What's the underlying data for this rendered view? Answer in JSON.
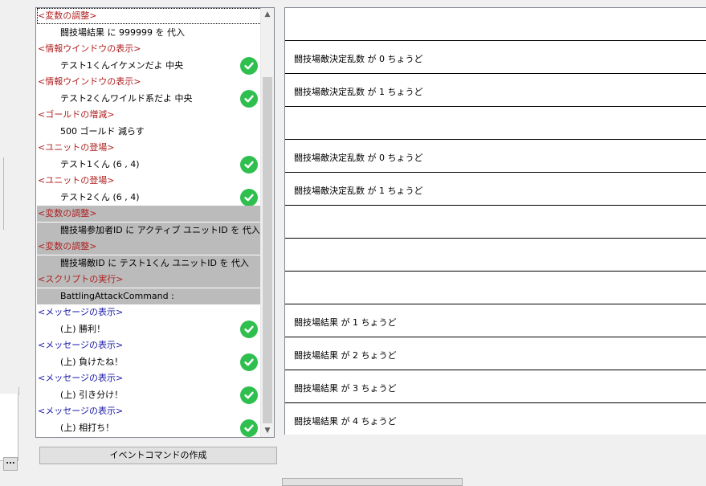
{
  "command_list": {
    "rows": [
      {
        "text": "<変数の調整>",
        "kind": "head",
        "color": "#b02020"
      },
      {
        "text": "闘技場結果 に 999999 を 代入",
        "kind": "sub",
        "check": false
      },
      {
        "text": "<情報ウインドウの表示>",
        "kind": "head",
        "color": "#b02020"
      },
      {
        "text": "テスト1くんイケメンだよ 中央",
        "kind": "sub",
        "check": true
      },
      {
        "text": "<情報ウインドウの表示>",
        "kind": "head",
        "color": "#b02020"
      },
      {
        "text": "テスト2くんワイルド系だよ 中央",
        "kind": "sub",
        "check": true
      },
      {
        "text": "<ゴールドの増減>",
        "kind": "head",
        "color": "#b02020"
      },
      {
        "text": "500 ゴールド 減らす",
        "kind": "sub",
        "check": false
      },
      {
        "text": "<ユニットの登場>",
        "kind": "head",
        "color": "#b02020"
      },
      {
        "text": "テスト1くん (6 , 4)",
        "kind": "sub",
        "check": true
      },
      {
        "text": "<ユニットの登場>",
        "kind": "head",
        "color": "#b02020"
      },
      {
        "text": "テスト2くん (6 , 4)",
        "kind": "sub",
        "check": true
      },
      {
        "text": "<変数の調整>",
        "kind": "head",
        "color": "#b02020",
        "selected": true
      },
      {
        "text": "闘技場参加者ID に アクティブ ユニットID を 代入",
        "kind": "sub",
        "selected": true
      },
      {
        "text": "<変数の調整>",
        "kind": "head",
        "color": "#b02020",
        "selected": true
      },
      {
        "text": "闘技場敵ID に テスト1くん ユニットID を 代入",
        "kind": "sub",
        "selected": true
      },
      {
        "text": "<スクリプトの実行>",
        "kind": "head",
        "color": "#b02020",
        "selected": true
      },
      {
        "text": "BattlingAttackCommand :",
        "kind": "sub",
        "selected": true
      },
      {
        "text": "<メッセージの表示>",
        "kind": "head",
        "color": "#1a1aa8"
      },
      {
        "text": "(上) 勝利！",
        "kind": "sub",
        "check": true
      },
      {
        "text": "<メッセージの表示>",
        "kind": "head",
        "color": "#1a1aa8"
      },
      {
        "text": "(上) 負けたね！",
        "kind": "sub",
        "check": true
      },
      {
        "text": "<メッセージの表示>",
        "kind": "head",
        "color": "#1a1aa8"
      },
      {
        "text": "(上) 引き分け！",
        "kind": "sub",
        "check": true
      },
      {
        "text": "<メッセージの表示>",
        "kind": "head",
        "color": "#1a1aa8"
      },
      {
        "text": "(上) 相打ち！",
        "kind": "sub",
        "check": true
      }
    ]
  },
  "conditions": [
    "",
    "闘技場敵決定乱数 が 0 ちょうど",
    "闘技場敵決定乱数 が 1 ちょうど",
    "",
    "闘技場敵決定乱数 が 0 ちょうど",
    "闘技場敵決定乱数 が 1 ちょうど",
    "",
    "",
    "",
    "闘技場結果 が 1 ちょうど",
    "闘技場結果 が 2 ちょうど",
    "闘技場結果 が 3 ちょうど",
    "闘技場結果 が 4 ちょうど"
  ],
  "buttons": {
    "create_event_command": "イベントコマンドの作成",
    "ellipsis": "..."
  },
  "colors": {
    "selection": "#bbbbbb",
    "check": "#2fbf4f",
    "category_red": "#b02020",
    "category_blue": "#1a1aa8"
  }
}
